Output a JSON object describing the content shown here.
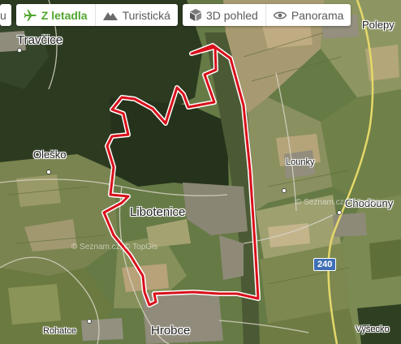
{
  "toolbar": {
    "partial_label": "u",
    "aerial_label": "Z letadla",
    "tourist_label": "Turistická",
    "view3d_label": "3D pohled",
    "panorama_label": "Panorama"
  },
  "map": {
    "places": {
      "travcice": "Travčice",
      "olesko": "Oleško",
      "libotenice": "Libotenice",
      "hrobce": "Hrobce",
      "rohatce": "Rohatce",
      "lounky": "Lounky",
      "chodouny": "Chodouny",
      "polepy": "Polepy",
      "vysecko": "Výšecko"
    },
    "road_number": "240",
    "watermark": "© Seznam.cz, © TopGis",
    "route_color": "#d8101a",
    "road_color": "#e5d86a"
  }
}
